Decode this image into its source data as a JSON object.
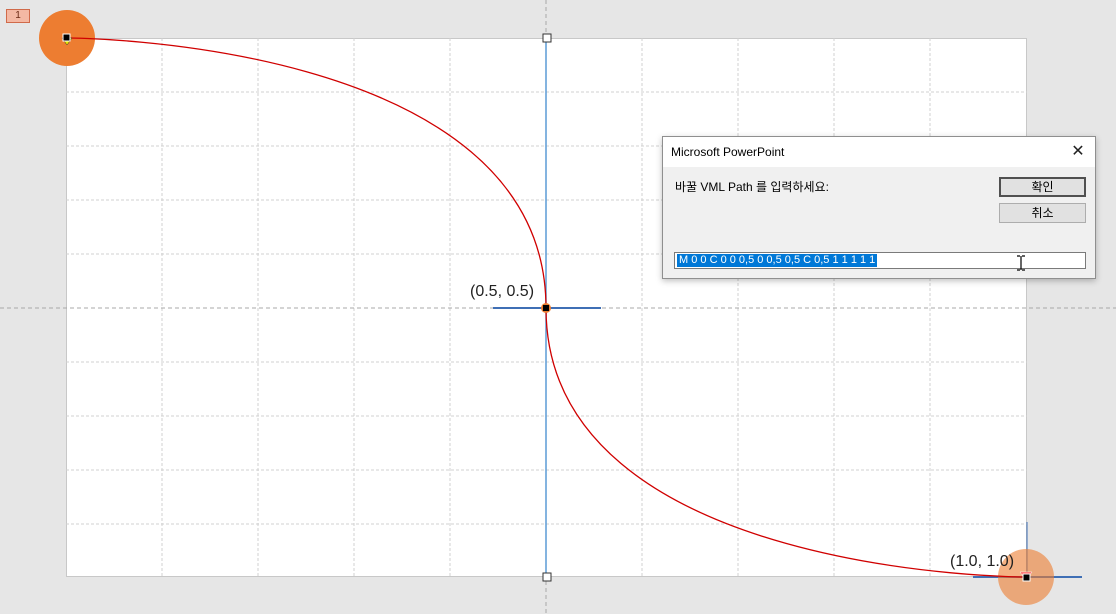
{
  "slide": {
    "thumb_number": "1",
    "labels": {
      "mid": "(0.5, 0.5)",
      "end": "(1.0, 1.0)"
    }
  },
  "colors": {
    "curve": "#d00000",
    "handle": "#ed7d31",
    "guide": "#5b9bd5"
  },
  "icons": [
    "close-icon",
    "ibeam-cursor-icon"
  ],
  "dialog": {
    "title": "Microsoft PowerPoint",
    "prompt": "바꿀 VML Path 를 입력하세요:",
    "ok_label": "확인",
    "cancel_label": "취소",
    "input_value": "M 0 0 C 0 0 0,5 0 0,5 0,5 C 0,5 1 1 1 1 1"
  }
}
